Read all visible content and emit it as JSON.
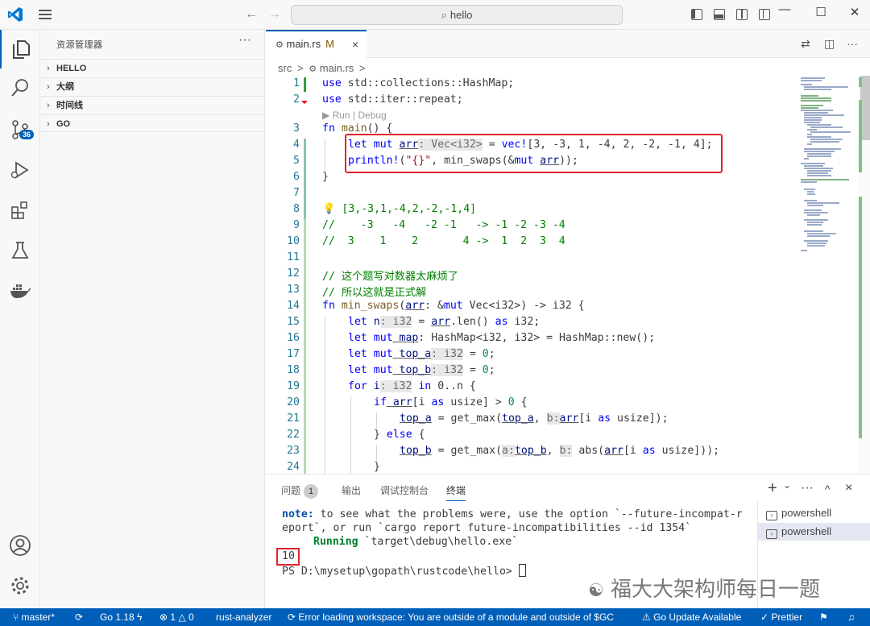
{
  "titlebar": {
    "search": "hello",
    "back": "←",
    "forward": "→"
  },
  "activity": {
    "scm_badge": "36"
  },
  "sidebar": {
    "title": "资源管理器",
    "more": "···",
    "sections": [
      {
        "label": "HELLO"
      },
      {
        "label": "大纲"
      },
      {
        "label": "时间线"
      },
      {
        "label": "GO"
      }
    ]
  },
  "tabs": [
    {
      "label": "main.rs",
      "modified": "M",
      "close": "×"
    }
  ],
  "breadcrumb": {
    "folder": "src",
    "sep": ">",
    "file": "main.rs",
    "sep2": ">"
  },
  "codelens": "▶ Run | Debug",
  "editor": {
    "line_numbers": [
      "1",
      "2",
      "3",
      "4",
      "5",
      "6",
      "7",
      "8",
      "9",
      "10",
      "11",
      "12",
      "13",
      "14",
      "15",
      "16",
      "17",
      "18",
      "19",
      "20",
      "21",
      "22",
      "23",
      "24"
    ]
  },
  "code": {
    "l1_use": "use",
    "l1_rest": " std::collections::HashMap;",
    "l2_use": "use",
    "l2_rest": " std::iter::repeat;",
    "l3_fn": "fn",
    "l3_name": " main",
    "l3_rest": "() {",
    "l4_let": "let",
    "l4_mut": " mut",
    "l4_arr": "arr",
    "l4_hint": ": Vec<i32>",
    "l4_eq": " = ",
    "l4_vec": "vec!",
    "l4_vals": "[3, -3, 1, -4, 2, -2, -1, 4];",
    "l5_println": "println!",
    "l5_open": "(",
    "l5_fmt": "\"{}\"",
    "l5_mid": ", min_swaps(&",
    "l5_mut": "mut",
    "l5_arr": "arr",
    "l5_close": "));",
    "l6": "}",
    "l8": "[3,-3,1,-4,2,-2,-1,4]",
    "l9": "//    -3   -4   -2 -1   -> -1 -2 -3 -4",
    "l10": "//  3    1    2       4 ->  1  2  3  4",
    "l12": "// 这个题写对数器太麻烦了",
    "l13": "// 所以这就是正式解",
    "l14_fn": "fn",
    "l14_name": " min_swaps",
    "l14_open": "(",
    "l14_arr": "arr",
    "l14_colon": ": &",
    "l14_mut": "mut",
    "l14_ty": " Vec<i32>",
    "l14_rest": ") -> i32 {",
    "l15_let": "let",
    "l15_n": " n",
    "l15_hint": ": i32",
    "l15_eq": " = ",
    "l15_arr": "arr",
    "l15_len": ".len() ",
    "l15_as": "as",
    "l15_ty": " i32;",
    "l16_let": "let",
    "l16_mut": " mut",
    "l16_map": " map",
    "l16_rest": ": HashMap<i32, i32> = HashMap::new();",
    "l17_let": "let",
    "l17_mut": " mut",
    "l17_var": " top_a",
    "l17_hint": ": i32",
    "l17_eq": " = ",
    "l17_num": "0",
    "l17_semi": ";",
    "l18_let": "let",
    "l18_mut": " mut",
    "l18_var": " top_b",
    "l18_hint": ": i32",
    "l18_eq": " = ",
    "l18_num": "0",
    "l18_semi": ";",
    "l19_for": "for",
    "l19_i": " i",
    "l19_hint": ": i32",
    "l19_in": " in ",
    "l19_range": "0..n {",
    "l20_if": "if",
    "l20_arr": " arr",
    "l20_idx": "[i ",
    "l20_as": "as",
    "l20_rest": " usize] > ",
    "l20_num": "0",
    "l20_brace": " {",
    "l21_var": "top_a",
    "l21_eq": " = get_max(",
    "l21_arg": "top_a",
    "l21_hint": "b:",
    "l21_arr": "arr",
    "l21_idx": "[i ",
    "l21_as": "as",
    "l21_rest": " usize]);",
    "l22_close": "} ",
    "l22_else": "else",
    "l22_brace": " {",
    "l23_var": "top_b",
    "l23_eq": " = get_max(",
    "l23_hint_a": "a:",
    "l23_arg": "top_b",
    "l23_hint_b": "b:",
    "l23_abs": " abs(",
    "l23_arr": "arr",
    "l23_idx": "[i ",
    "l23_as": "as",
    "l23_rest": " usize]));",
    "l24": "}"
  },
  "panel": {
    "tabs": [
      {
        "label": "问题",
        "count": "1"
      },
      {
        "label": "输出"
      },
      {
        "label": "调试控制台"
      },
      {
        "label": "终端"
      }
    ],
    "actions": {
      "add": "+",
      "dropdown": "⌄",
      "more": "···",
      "maximize": "^",
      "close": "×"
    },
    "terminal": {
      "note_label": "note:",
      "note_text": " to see what the problems were, use the option `--future-incompat-r",
      "note_cont": "eport`, or run `cargo report future-incompatibilities --id 1354`",
      "running_label": "Running",
      "running_text": " `target\\debug\\hello.exe`",
      "output": "10",
      "prompt": "PS D:\\mysetup\\gopath\\rustcode\\hello> "
    },
    "terminal_list": [
      {
        "label": "powershell"
      },
      {
        "label": "powershell"
      }
    ]
  },
  "watermark": "福大大架构师每日一题",
  "status": {
    "branch": "master*",
    "sync": "⟳",
    "go_version": "Go 1.18",
    "errors": "⊗ 1",
    "warnings": "△ 0",
    "rust_analyzer": "rust-analyzer",
    "error_msg": "⟳ Error loading workspace: You are outside of a module and outside of $GC",
    "go_update": "⚠ Go Update Available",
    "prettier": "✓ Prettier"
  },
  "colors": {
    "accent": "#005fb8",
    "highlight_box": "#e0242c"
  }
}
